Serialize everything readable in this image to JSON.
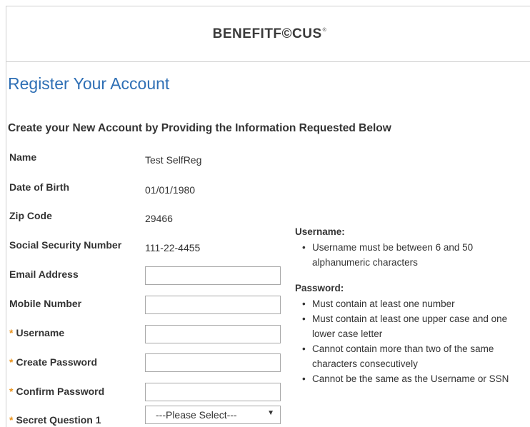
{
  "header": {
    "logo_text": "BENEFITF©CUS",
    "logo_mark": "®"
  },
  "page_title": "Register Your Account",
  "subtitle": "Create your New Account by Providing the Information Requested Below",
  "fields": {
    "name": {
      "label": "Name",
      "value": "Test SelfReg"
    },
    "dob": {
      "label": "Date of Birth",
      "value": "01/01/1980"
    },
    "zip": {
      "label": "Zip Code",
      "value": "29466"
    },
    "ssn": {
      "label": "Social Security Number",
      "value": "111-22-4455"
    },
    "email": {
      "label": "Email Address",
      "value": ""
    },
    "mobile": {
      "label": "Mobile Number",
      "value": ""
    },
    "username": {
      "label": "Username",
      "value": ""
    },
    "create_password": {
      "label": "Create Password",
      "value": ""
    },
    "confirm_password": {
      "label": "Confirm Password",
      "value": ""
    },
    "secret_q1": {
      "label": "Secret Question 1",
      "selected": "---Please Select---"
    }
  },
  "required_marker": "*",
  "help": {
    "username_title": "Username:",
    "username_rules": [
      "Username must be between 6 and 50 alphanumeric characters"
    ],
    "password_title": "Password:",
    "password_rules": [
      "Must contain at least one number",
      "Must contain at least one upper case and one lower case letter",
      "Cannot contain more than two of the same characters consecutively",
      "Cannot be the same as the Username or SSN"
    ]
  }
}
